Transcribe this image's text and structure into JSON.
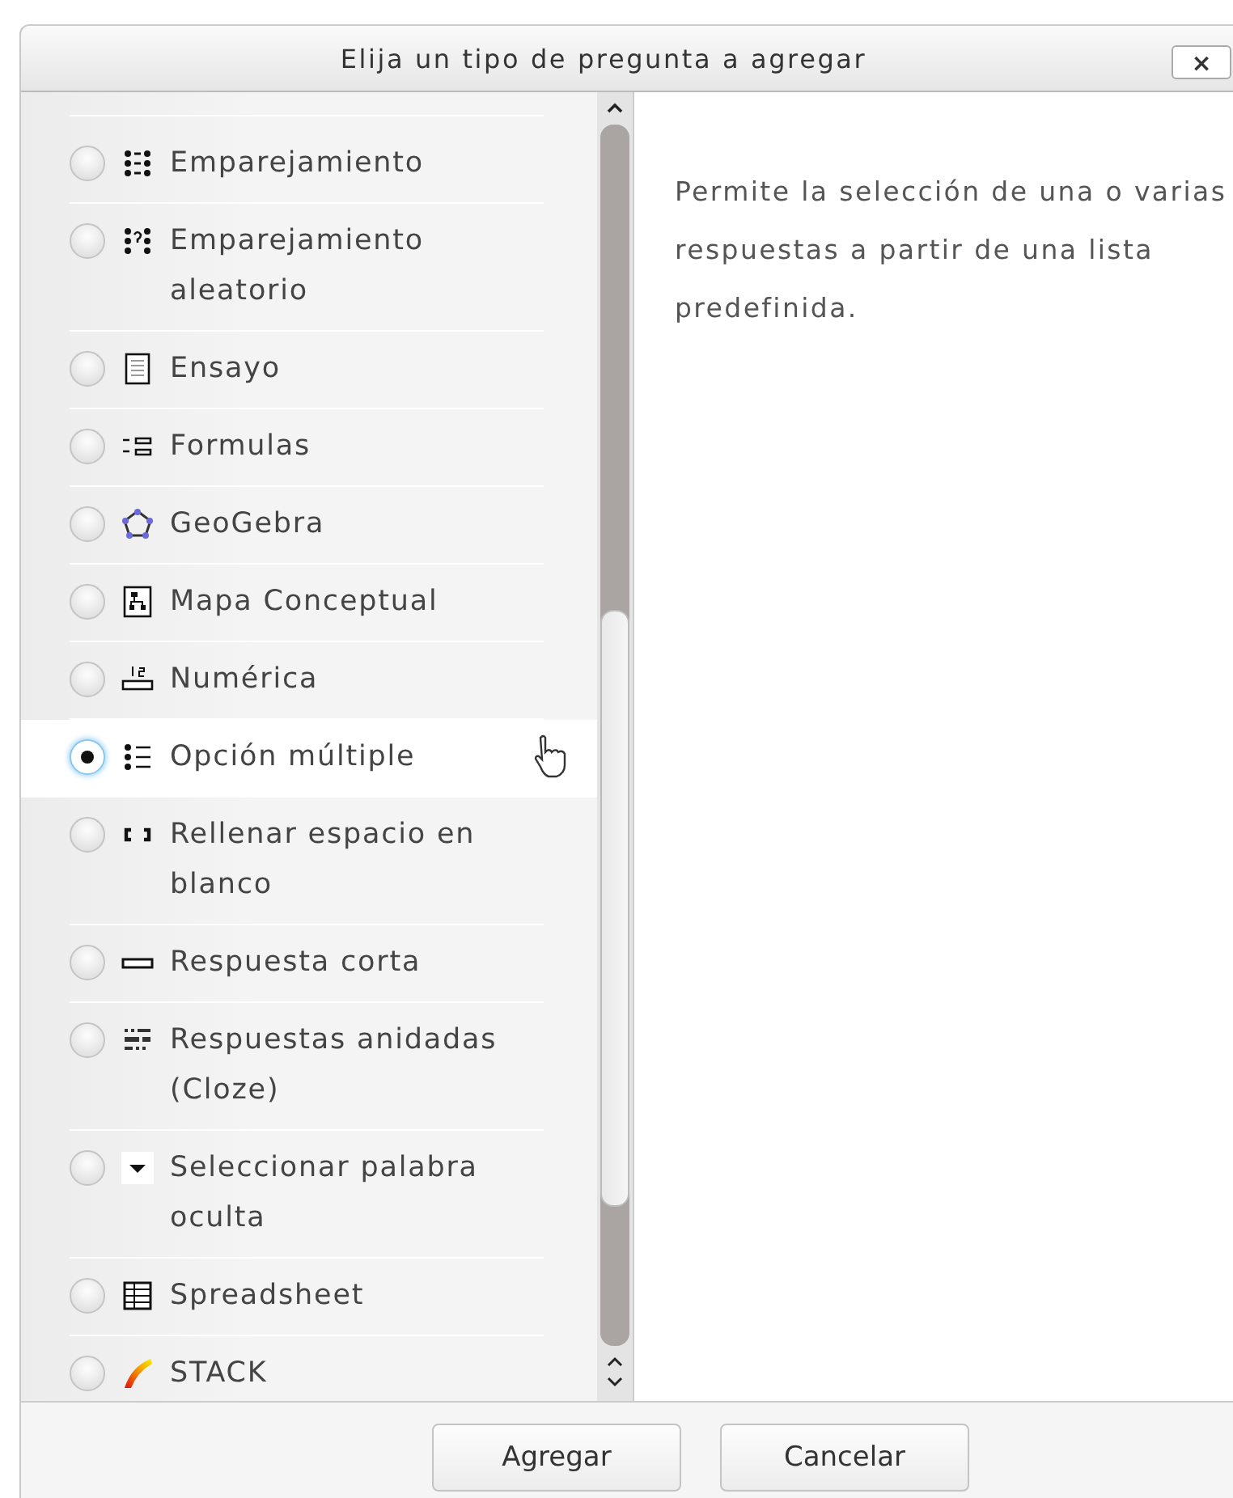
{
  "dialog": {
    "title": "Elija un tipo de pregunta a agregar",
    "close_label": "×"
  },
  "question_types": [
    {
      "label": "Emparejamiento",
      "kind": "matching",
      "selected": false
    },
    {
      "label": "Emparejamiento aleatorio",
      "kind": "randommatching",
      "selected": false
    },
    {
      "label": "Ensayo",
      "kind": "essay",
      "selected": false
    },
    {
      "label": "Formulas",
      "kind": "formulas",
      "selected": false
    },
    {
      "label": "GeoGebra",
      "kind": "geogebra",
      "selected": false
    },
    {
      "label": "Mapa Conceptual",
      "kind": "conceptmap",
      "selected": false
    },
    {
      "label": "Numérica",
      "kind": "numerical",
      "selected": false
    },
    {
      "label": "Opción múltiple",
      "kind": "multichoice",
      "selected": true
    },
    {
      "label": "Rellenar espacio en blanco",
      "kind": "gapfill",
      "selected": false
    },
    {
      "label": "Respuesta corta",
      "kind": "shortanswer",
      "selected": false
    },
    {
      "label": "Respuestas anidadas (Cloze)",
      "kind": "cloze",
      "selected": false
    },
    {
      "label": "Seleccionar palabra oculta",
      "kind": "gapselect",
      "selected": false
    },
    {
      "label": "Spreadsheet",
      "kind": "spreadsheet",
      "selected": false
    },
    {
      "label": "STACK",
      "kind": "stack",
      "selected": false
    }
  ],
  "description": "Permite la selección de una o varias respuestas a partir de una lista predefinida.",
  "buttons": [
    "Agregar",
    "Cancelar"
  ]
}
